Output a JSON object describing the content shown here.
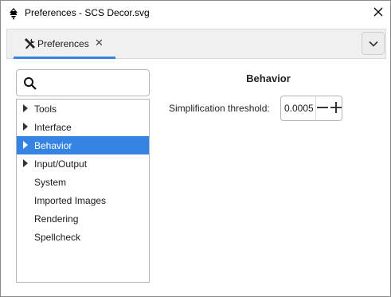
{
  "window": {
    "title": "Preferences - SCS Decor.svg",
    "app_icon": "inkscape-icon",
    "close_icon": "close-icon"
  },
  "notebook": {
    "tab": {
      "label": "Preferences",
      "icon": "tools-icon",
      "close_icon": "close-icon"
    },
    "menu_icon": "chevron-down-icon"
  },
  "search": {
    "value": "",
    "icon": "search-icon"
  },
  "tree": {
    "items": [
      {
        "label": "Tools",
        "expandable": true,
        "selected": false
      },
      {
        "label": "Interface",
        "expandable": true,
        "selected": false
      },
      {
        "label": "Behavior",
        "expandable": true,
        "selected": true
      },
      {
        "label": "Input/Output",
        "expandable": true,
        "selected": false
      },
      {
        "label": "System",
        "expandable": false,
        "selected": false
      },
      {
        "label": "Imported Images",
        "expandable": false,
        "selected": false
      },
      {
        "label": "Rendering",
        "expandable": false,
        "selected": false
      },
      {
        "label": "Spellcheck",
        "expandable": false,
        "selected": false
      }
    ]
  },
  "page": {
    "title": "Behavior",
    "simplification": {
      "label": "Simplification threshold:",
      "value": "0.0005",
      "decrement_icon": "minus-icon",
      "increment_icon": "plus-icon"
    }
  },
  "colors": {
    "accent": "#3584e4",
    "selected_text": "#ffffff"
  }
}
